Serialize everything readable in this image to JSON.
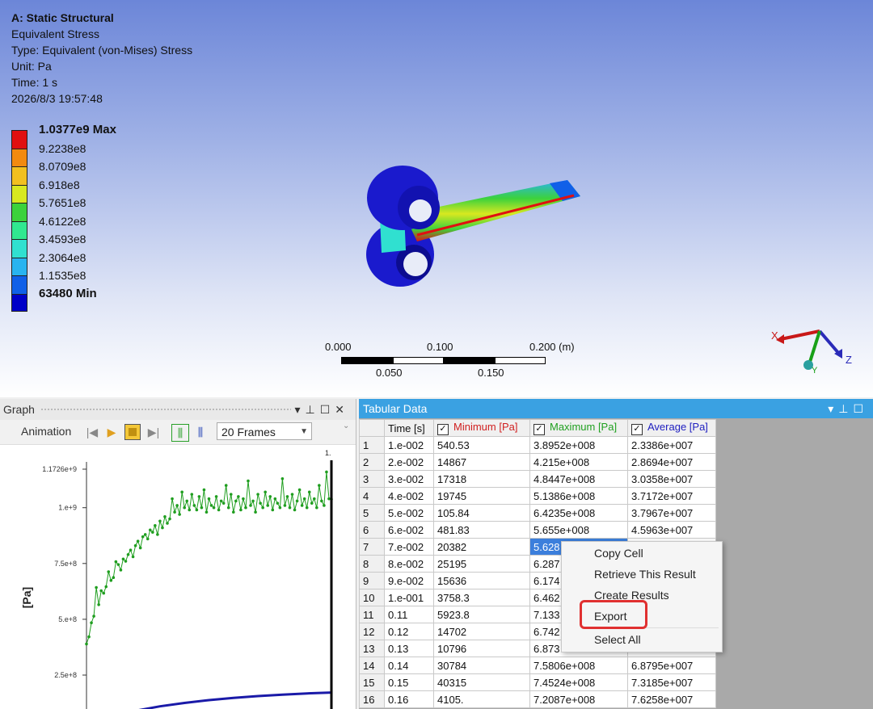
{
  "viewport": {
    "header": {
      "title": "A: Static Structural",
      "result": "Equivalent Stress",
      "type": "Type: Equivalent (von-Mises) Stress",
      "unit": "Unit: Pa",
      "time": "Time: 1 s",
      "timestamp": "2026/8/3 19:57:48"
    },
    "legend": {
      "labels": [
        "1.0377e9 Max",
        "9.2238e8",
        "8.0709e8",
        "6.918e8",
        "5.7651e8",
        "4.6122e8",
        "3.4593e8",
        "2.3064e8",
        "1.1535e8",
        "63480 Min"
      ],
      "colors": [
        "#e01010",
        "#f28a10",
        "#f2c020",
        "#d8e820",
        "#3cd23c",
        "#30e890",
        "#30e0d0",
        "#28b4f0",
        "#1060e8",
        "#0000c8"
      ]
    },
    "scale_bar": {
      "top_labels": [
        "0.000",
        "0.100",
        "0.200 (m)"
      ],
      "bottom_labels": [
        "0.050",
        "0.150"
      ]
    },
    "triad": {
      "x": "X",
      "y": "Y",
      "z": "Z"
    }
  },
  "graph": {
    "title": "Graph",
    "animation_label": "Animation",
    "frames_value": "20 Frames",
    "y_axis_label": "[Pa]",
    "cursor_label": "1.",
    "icons": [
      "pin-icon",
      "maximize-icon",
      "close-icon",
      "first-frame-icon",
      "play-icon",
      "stop-icon",
      "last-frame-icon",
      "distributed-icon",
      "uniform-icon"
    ]
  },
  "chart_data": {
    "type": "line",
    "title": "",
    "xlabel": "",
    "ylabel": "[Pa]",
    "yticks": [
      "1.1726e+9",
      "1.e+9",
      "7.5e+8",
      "5.e+8",
      "2.5e+8"
    ],
    "ytick_values": [
      1172600000,
      1000000000,
      750000000,
      500000000,
      250000000
    ],
    "xlim": [
      0,
      1
    ],
    "series": [
      {
        "color": "#1f9e1f",
        "marker": "circle",
        "x": [
          0.0,
          0.01,
          0.02,
          0.03,
          0.04,
          0.05,
          0.06,
          0.07,
          0.08,
          0.09,
          0.1,
          0.11,
          0.12,
          0.13,
          0.14,
          0.15,
          0.16,
          0.17,
          0.18,
          0.19,
          0.2,
          0.21,
          0.22,
          0.23,
          0.24,
          0.25,
          0.26,
          0.27,
          0.28,
          0.29,
          0.3,
          0.31,
          0.32,
          0.33,
          0.34,
          0.35,
          0.36,
          0.37,
          0.38,
          0.39,
          0.4,
          0.41,
          0.42,
          0.43,
          0.44,
          0.45,
          0.46,
          0.47,
          0.48,
          0.49,
          0.5,
          0.51,
          0.52,
          0.53,
          0.54,
          0.55,
          0.56,
          0.57,
          0.58,
          0.59,
          0.6,
          0.61,
          0.62,
          0.63,
          0.64,
          0.65,
          0.66,
          0.67,
          0.68,
          0.69,
          0.7,
          0.71,
          0.72,
          0.73,
          0.74,
          0.75,
          0.76,
          0.77,
          0.78,
          0.79,
          0.8,
          0.81,
          0.82,
          0.83,
          0.84,
          0.85,
          0.86,
          0.87,
          0.88,
          0.89,
          0.9,
          0.91,
          0.92,
          0.93,
          0.94,
          0.95,
          0.96,
          0.97,
          0.98,
          0.99,
          1.0
        ],
        "y": [
          389500000,
          421500000,
          484470000,
          513860000,
          642350000,
          565500000,
          628000000,
          617000000,
          646000000,
          713000000,
          674000000,
          687000000,
          758060000,
          745240000,
          720870000,
          770000000,
          760000000,
          790000000,
          810000000,
          780000000,
          830000000,
          850000000,
          820000000,
          870000000,
          880000000,
          860000000,
          900000000,
          890000000,
          920000000,
          880000000,
          940000000,
          910000000,
          960000000,
          930000000,
          950000000,
          1040000000,
          980000000,
          1010000000,
          970000000,
          1070000000,
          1000000000,
          1030000000,
          990000000,
          1060000000,
          1010000000,
          990000000,
          1050000000,
          1000000000,
          1080000000,
          980000000,
          1040000000,
          1010000000,
          1000000000,
          1050000000,
          990000000,
          1030000000,
          1020000000,
          1100000000,
          1000000000,
          1060000000,
          980000000,
          1030000000,
          1050000000,
          990000000,
          1040000000,
          1000000000,
          1120000000,
          1010000000,
          1030000000,
          980000000,
          1060000000,
          1020000000,
          1000000000,
          1070000000,
          1010000000,
          1050000000,
          990000000,
          1040000000,
          1020000000,
          1000000000,
          1130000000,
          1010000000,
          1050000000,
          1000000000,
          1060000000,
          990000000,
          1030000000,
          1080000000,
          1010000000,
          1040000000,
          1000000000,
          1070000000,
          1020000000,
          1040000000,
          1000000000,
          1100000000,
          1030000000,
          1010000000,
          1160000000,
          1040000000,
          1037700000
        ]
      },
      {
        "color": "#1a1aa8",
        "marker": "none",
        "x": [
          0.0,
          0.1,
          0.2,
          0.3,
          0.4,
          0.5,
          0.6,
          0.7,
          0.8,
          0.9,
          1.0
        ],
        "y": [
          23386000,
          60000000,
          90000000,
          110000000,
          125000000,
          138000000,
          148000000,
          156000000,
          162000000,
          168000000,
          172000000
        ]
      }
    ]
  },
  "tabular": {
    "title": "Tabular Data",
    "headers": [
      "",
      "Time [s]",
      "Minimum [Pa]",
      "Maximum [Pa]",
      "Average [Pa]"
    ],
    "header_colors": [
      "#111111",
      "#111111",
      "#d02020",
      "#20a020",
      "#2020c0"
    ],
    "rows": [
      [
        "1",
        "1.e-002",
        "540.53",
        "3.8952e+008",
        "2.3386e+007"
      ],
      [
        "2",
        "2.e-002",
        "14867",
        "4.215e+008",
        "2.8694e+007"
      ],
      [
        "3",
        "3.e-002",
        "17318",
        "4.8447e+008",
        "3.0358e+007"
      ],
      [
        "4",
        "4.e-002",
        "19745",
        "5.1386e+008",
        "3.7172e+007"
      ],
      [
        "5",
        "5.e-002",
        "105.84",
        "6.4235e+008",
        "3.7967e+007"
      ],
      [
        "6",
        "6.e-002",
        "481.83",
        "5.655e+008",
        "4.5963e+007"
      ],
      [
        "7",
        "7.e-002",
        "20382",
        "5.628",
        ""
      ],
      [
        "8",
        "8.e-002",
        "25195",
        "6.287",
        ""
      ],
      [
        "9",
        "9.e-002",
        "15636",
        "6.174",
        ""
      ],
      [
        "10",
        "1.e-001",
        "3758.3",
        "6.462",
        ""
      ],
      [
        "11",
        "0.11",
        "5923.8",
        "7.133",
        ""
      ],
      [
        "12",
        "0.12",
        "14702",
        "6.742",
        ""
      ],
      [
        "13",
        "0.13",
        "10796",
        "6.873",
        ""
      ],
      [
        "14",
        "0.14",
        "30784",
        "7.5806e+008",
        "6.8795e+007"
      ],
      [
        "15",
        "0.15",
        "40315",
        "7.4524e+008",
        "7.3185e+007"
      ],
      [
        "16",
        "0.16",
        "4105.",
        "7.2087e+008",
        "7.6258e+007"
      ]
    ]
  },
  "context_menu": {
    "items": [
      "Copy Cell",
      "Retrieve This Result",
      "Create Results",
      "Export",
      "Select All"
    ]
  }
}
